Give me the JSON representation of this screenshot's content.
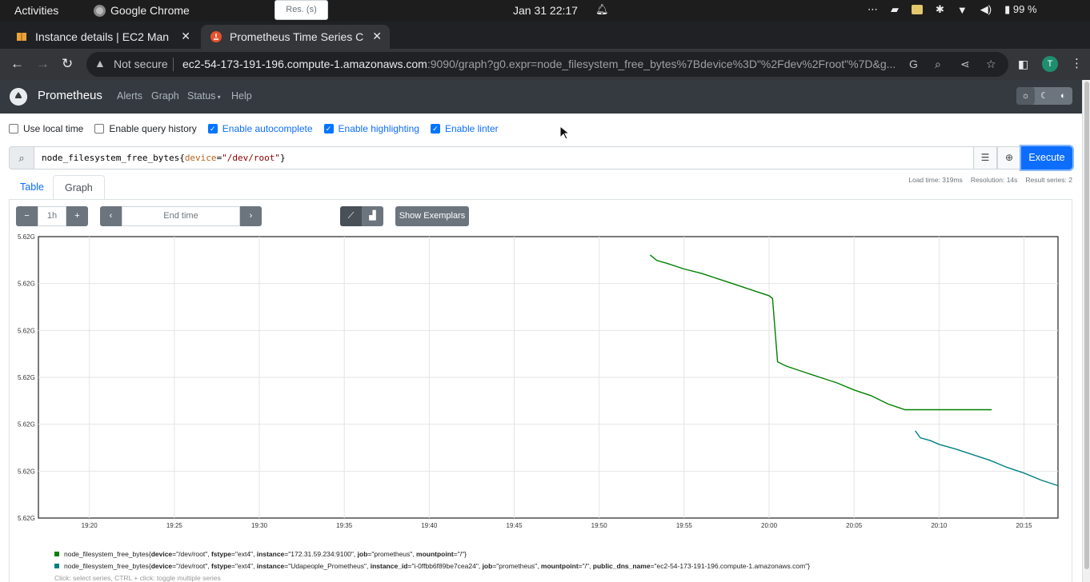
{
  "os": {
    "activities": "Activities",
    "app_name": "Google Chrome",
    "clock": "Jan 31  22:17",
    "battery": "99 %"
  },
  "browser": {
    "tabs": [
      {
        "title": "Instance details | EC2 Man",
        "active": false
      },
      {
        "title": "Prometheus Time Series C",
        "active": true
      }
    ],
    "security_label": "Not secure",
    "url_host": "ec2-54-173-191-196.compute-1.amazonaws.com",
    "url_rest": ":9090/graph?g0.expr=node_filesystem_free_bytes%7Bdevice%3D\"%2Fdev%2Froot\"%7D&g...",
    "profile_initial": "T"
  },
  "prometheus": {
    "brand": "Prometheus",
    "nav": [
      "Alerts",
      "Graph",
      "Status",
      "Help"
    ],
    "options": [
      {
        "label": "Use local time",
        "checked": false
      },
      {
        "label": "Enable query history",
        "checked": false
      },
      {
        "label": "Enable autocomplete",
        "checked": true
      },
      {
        "label": "Enable highlighting",
        "checked": true
      },
      {
        "label": "Enable linter",
        "checked": true
      }
    ],
    "query": {
      "metric": "node_filesystem_free_bytes",
      "label_key": "device",
      "label_value": "\"/dev/root\""
    },
    "execute_label": "Execute",
    "stats": {
      "load_time": "Load time: 319ms",
      "resolution": "Resolution: 14s",
      "result_series": "Result series: 2"
    },
    "tabs": {
      "table": "Table",
      "graph": "Graph"
    },
    "controls": {
      "minus": "−",
      "range": "1h",
      "plus": "+",
      "end_time_placeholder": "End time",
      "res_placeholder": "Res. (s)",
      "show_exemplars": "Show Exemplars"
    },
    "hint": "Click: select series, CTRL + click: toggle multiple series"
  },
  "chart_data": {
    "type": "line",
    "x_ticks": [
      "19:20",
      "19:25",
      "19:30",
      "19:35",
      "19:40",
      "19:45",
      "19:50",
      "19:55",
      "20:00",
      "20:05",
      "20:10",
      "20:15"
    ],
    "y_ticks": [
      "5.62G",
      "5.62G",
      "5.62G",
      "5.62G",
      "5.62G",
      "5.62G",
      "5.62G"
    ],
    "xlim_minutes": [
      "19:17",
      "20:17"
    ],
    "grid": true,
    "legend_position": "bottom",
    "series": [
      {
        "color": "#008000",
        "legend": {
          "metric": "node_filesystem_free_bytes",
          "labels": [
            {
              "k": "device",
              "v": "\"/dev/root\""
            },
            {
              "k": "fstype",
              "v": "\"ext4\""
            },
            {
              "k": "instance",
              "v": "\"172.31.59.234:9100\""
            },
            {
              "k": "job",
              "v": "\"prometheus\""
            },
            {
              "k": "mountpoint",
              "v": "\"/\""
            }
          ]
        },
        "points": [
          [
            "19:53.0",
            0.935
          ],
          [
            "19:53.4",
            0.915
          ],
          [
            "19:54.0",
            0.905
          ],
          [
            "19:55.0",
            0.885
          ],
          [
            "19:56.0",
            0.87
          ],
          [
            "19:57.0",
            0.85
          ],
          [
            "19:58.0",
            0.83
          ],
          [
            "19:59.0",
            0.81
          ],
          [
            "20:00.0",
            0.79
          ],
          [
            "20:00.2",
            0.78
          ],
          [
            "20:00.5",
            0.555
          ],
          [
            "20:01.0",
            0.54
          ],
          [
            "20:02.0",
            0.52
          ],
          [
            "20:03.0",
            0.5
          ],
          [
            "20:04.0",
            0.48
          ],
          [
            "20:05.0",
            0.455
          ],
          [
            "20:06.0",
            0.435
          ],
          [
            "20:07.0",
            0.405
          ],
          [
            "20:08.0",
            0.385
          ],
          [
            "20:13.1",
            0.385
          ]
        ]
      },
      {
        "color": "#008080",
        "legend": {
          "metric": "node_filesystem_free_bytes",
          "labels": [
            {
              "k": "device",
              "v": "\"/dev/root\""
            },
            {
              "k": "fstype",
              "v": "\"ext4\""
            },
            {
              "k": "instance",
              "v": "\"Udapeople_Prometheus\""
            },
            {
              "k": "instance_id",
              "v": "\"i-0ffbb6f89be7cea24\""
            },
            {
              "k": "job",
              "v": "\"prometheus\""
            },
            {
              "k": "mountpoint",
              "v": "\"/\""
            },
            {
              "k": "public_dns_name",
              "v": "\"ec2-54-173-191-196.compute-1.amazonaws.com\""
            }
          ]
        },
        "points": [
          [
            "20:08.6",
            0.31
          ],
          [
            "20:08.9",
            0.285
          ],
          [
            "20:09.5",
            0.275
          ],
          [
            "20:10.0",
            0.262
          ],
          [
            "20:11.0",
            0.245
          ],
          [
            "20:12.0",
            0.225
          ],
          [
            "20:13.0",
            0.205
          ],
          [
            "20:14.0",
            0.18
          ],
          [
            "20:15.0",
            0.16
          ],
          [
            "20:16.0",
            0.135
          ],
          [
            "20:17.0",
            0.115
          ]
        ]
      }
    ]
  }
}
